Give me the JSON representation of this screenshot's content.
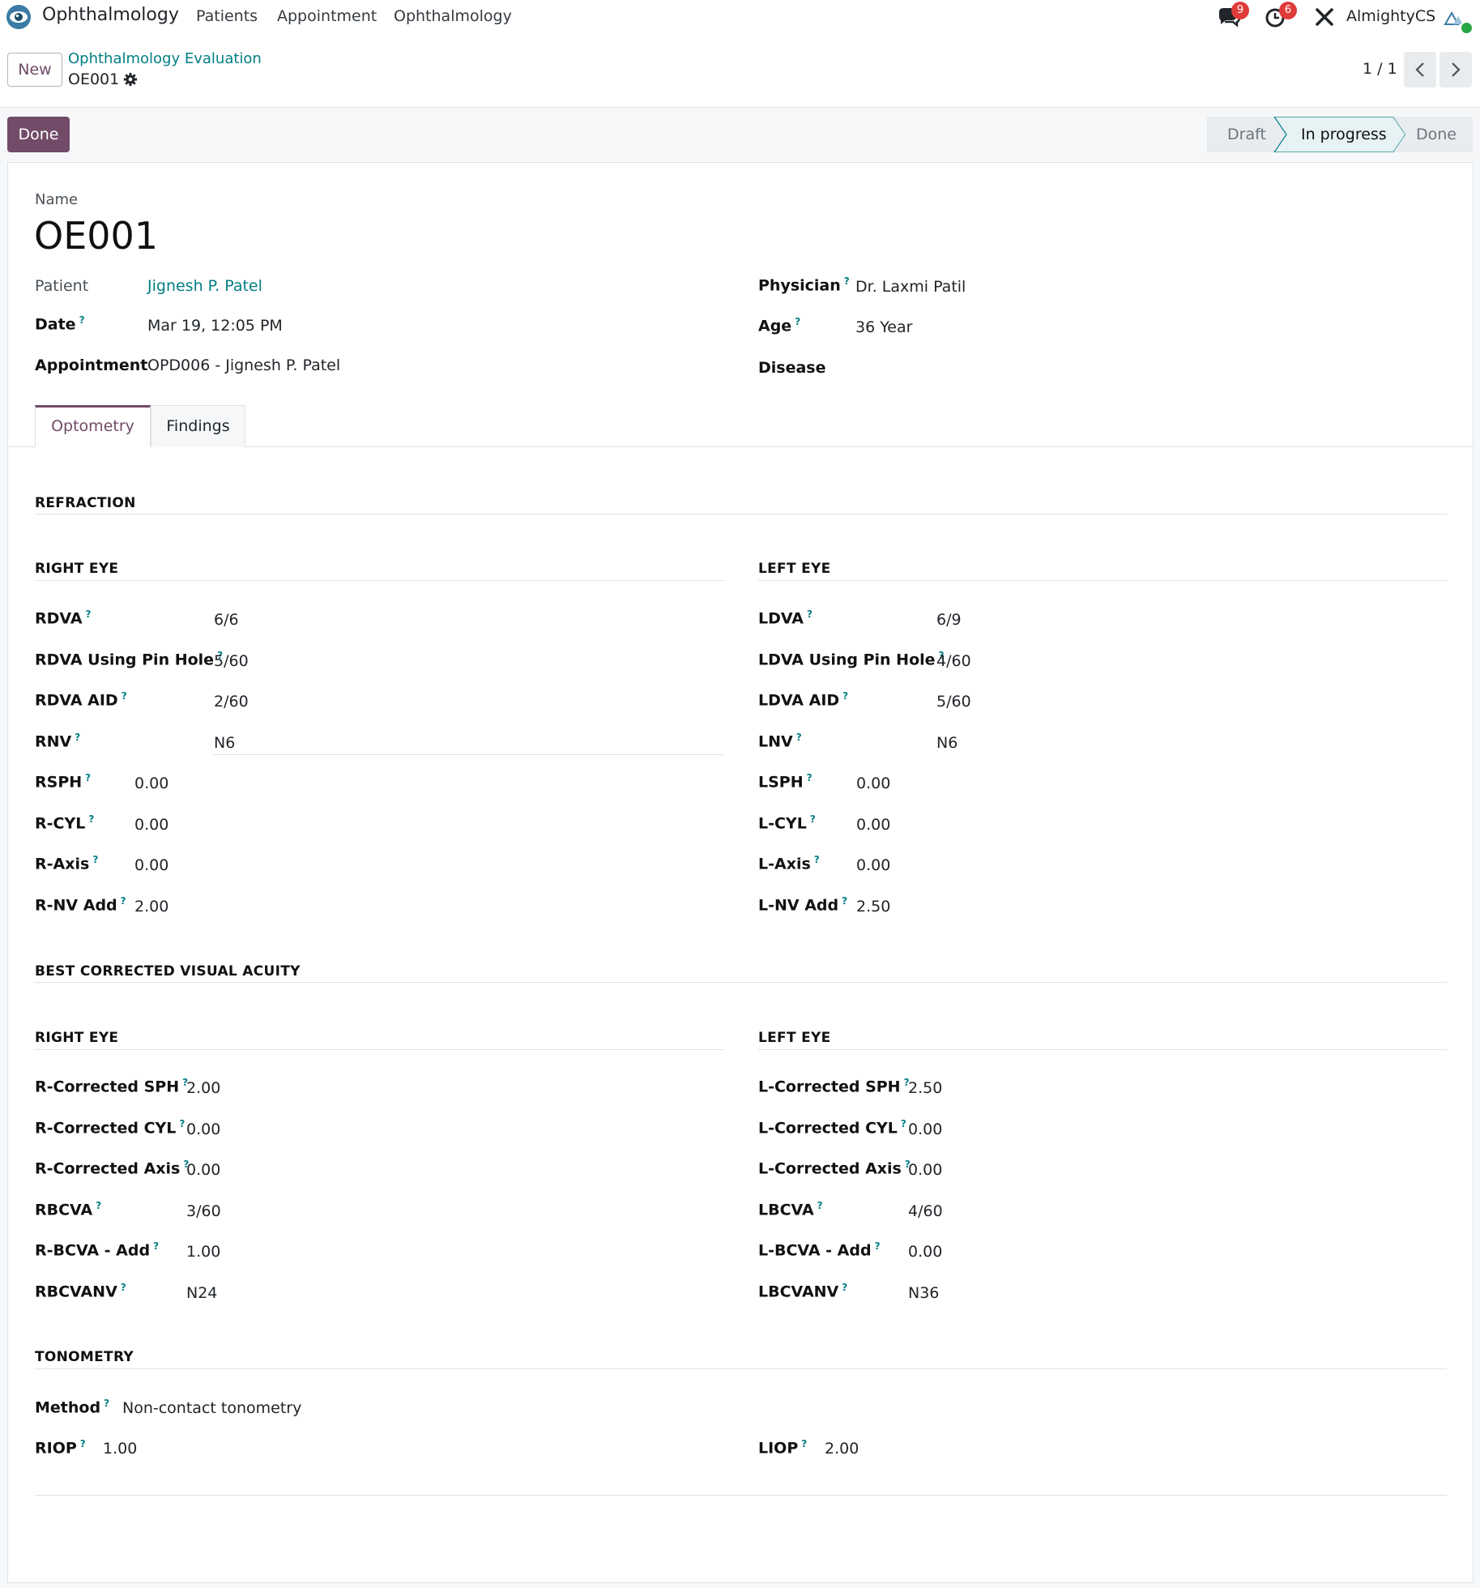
{
  "navbar": {
    "app_name": "Ophthalmology",
    "menu": [
      "Patients",
      "Appointment",
      "Ophthalmology"
    ],
    "messages_badge": "9",
    "activities_badge": "6",
    "company": "AlmightyCS"
  },
  "control": {
    "new_label": "New",
    "breadcrumb": "Ophthalmology Evaluation",
    "record": "OE001",
    "pager": "1 / 1"
  },
  "statusbar": {
    "action_label": "Done",
    "stages": [
      "Draft",
      "In progress",
      "Done"
    ],
    "current": "In progress"
  },
  "form": {
    "name_label": "Name",
    "name_value": "OE001",
    "patient_label": "Patient",
    "patient_value": "Jignesh P. Patel",
    "date_label": "Date",
    "date_value": "Mar 19, 12:05 PM",
    "appointment_label": "Appointment",
    "appointment_value": "OPD006 - Jignesh P. Patel",
    "physician_label": "Physician",
    "physician_value": "Dr. Laxmi Patil",
    "age_label": "Age",
    "age_value": "36 Year",
    "disease_label": "Disease",
    "disease_value": ""
  },
  "tabs": [
    "Optometry",
    "Findings"
  ],
  "refraction": {
    "title": "REFRACTION",
    "right_title": "RIGHT EYE",
    "left_title": "LEFT EYE",
    "right": [
      {
        "label": "RDVA",
        "value": "6/6"
      },
      {
        "label": "RDVA Using Pin Hole",
        "value": "5/60"
      },
      {
        "label": "RDVA AID",
        "value": "2/60"
      },
      {
        "label": "RNV",
        "value": "N6"
      },
      {
        "label": "RSPH",
        "value": "0.00"
      },
      {
        "label": "R-CYL",
        "value": "0.00"
      },
      {
        "label": "R-Axis",
        "value": "0.00"
      },
      {
        "label": "R-NV Add",
        "value": "2.00"
      }
    ],
    "left": [
      {
        "label": "LDVA",
        "value": "6/9"
      },
      {
        "label": "LDVA Using Pin Hole",
        "value": "4/60"
      },
      {
        "label": "LDVA AID",
        "value": "5/60"
      },
      {
        "label": "LNV",
        "value": "N6"
      },
      {
        "label": "LSPH",
        "value": "0.00"
      },
      {
        "label": "L-CYL",
        "value": "0.00"
      },
      {
        "label": "L-Axis",
        "value": "0.00"
      },
      {
        "label": "L-NV Add",
        "value": "2.50"
      }
    ]
  },
  "bcva": {
    "title": "BEST CORRECTED VISUAL ACUITY",
    "right_title": "RIGHT EYE",
    "left_title": "LEFT EYE",
    "right": [
      {
        "label": "R-Corrected SPH",
        "value": "2.00"
      },
      {
        "label": "R-Corrected CYL",
        "value": "0.00"
      },
      {
        "label": "R-Corrected Axis",
        "value": "0.00"
      },
      {
        "label": "RBCVA",
        "value": "3/60"
      },
      {
        "label": "R-BCVA - Add",
        "value": "1.00"
      },
      {
        "label": "RBCVANV",
        "value": "N24"
      }
    ],
    "left": [
      {
        "label": "L-Corrected SPH",
        "value": "2.50"
      },
      {
        "label": "L-Corrected CYL",
        "value": "0.00"
      },
      {
        "label": "L-Corrected Axis",
        "value": "0.00"
      },
      {
        "label": "LBCVA",
        "value": "4/60"
      },
      {
        "label": "L-BCVA - Add",
        "value": "0.00"
      },
      {
        "label": "LBCVANV",
        "value": "N36"
      }
    ]
  },
  "tonometry": {
    "title": "TONOMETRY",
    "method_label": "Method",
    "method_value": "Non-contact tonometry",
    "riop_label": "RIOP",
    "riop_value": "1.00",
    "liop_label": "LIOP",
    "liop_value": "2.00"
  },
  "help_mark": "?",
  "colors": {
    "primary": "#714b67",
    "link": "#017e84",
    "badge": "#e03b3b",
    "online": "#28a745"
  }
}
